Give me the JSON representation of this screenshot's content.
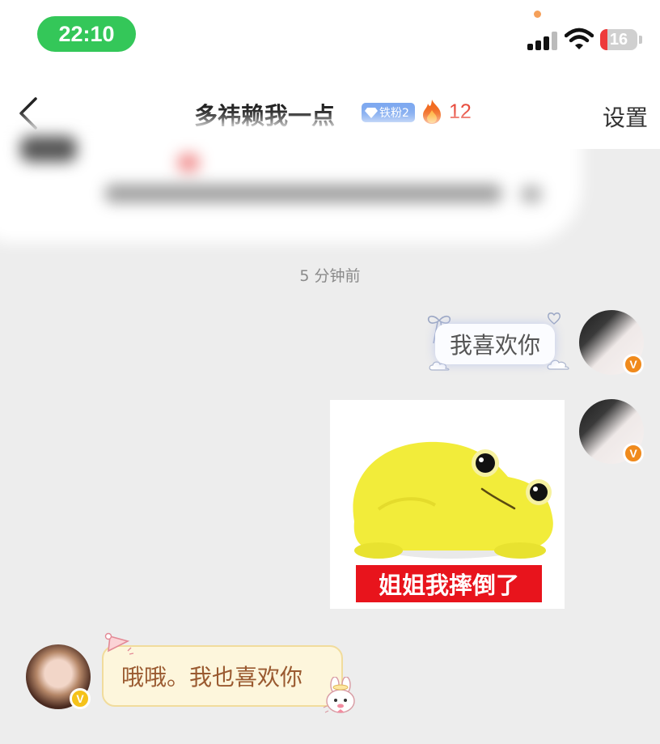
{
  "status_bar": {
    "time": "22:10",
    "battery_level": "16",
    "signal_icon": "cellular-signal-icon",
    "wifi_icon": "wifi-icon",
    "battery_icon": "battery-icon",
    "pill_color": "#34c759",
    "battery_low_color": "#ee3b3b"
  },
  "header": {
    "back_icon": "chevron-left-icon",
    "title": "多祎赖我一点",
    "fan_badge_label": "铁粉2",
    "fan_badge_icon": "diamond-icon",
    "streak_icon": "flame-icon",
    "streak_count": "12",
    "settings_label": "设置"
  },
  "chat": {
    "timestamp": "5 分钟前",
    "messages": [
      {
        "sender": "self",
        "type": "text",
        "text": "我喜欢你",
        "decorations": [
          "bow-icon",
          "heart-icon",
          "cloud-icon"
        ]
      },
      {
        "sender": "self",
        "type": "sticker",
        "caption": "姐姐我摔倒了",
        "image": "yellow-frog-sticker"
      },
      {
        "sender": "other",
        "type": "text",
        "text": "哦哦。我也喜欢你",
        "decorations": [
          "party-hat-icon",
          "bunny-icon"
        ]
      }
    ],
    "self_badge": "V",
    "other_badge": "V",
    "self_badge_color": "#f08a1c",
    "other_badge_color": "#f5c21a"
  }
}
